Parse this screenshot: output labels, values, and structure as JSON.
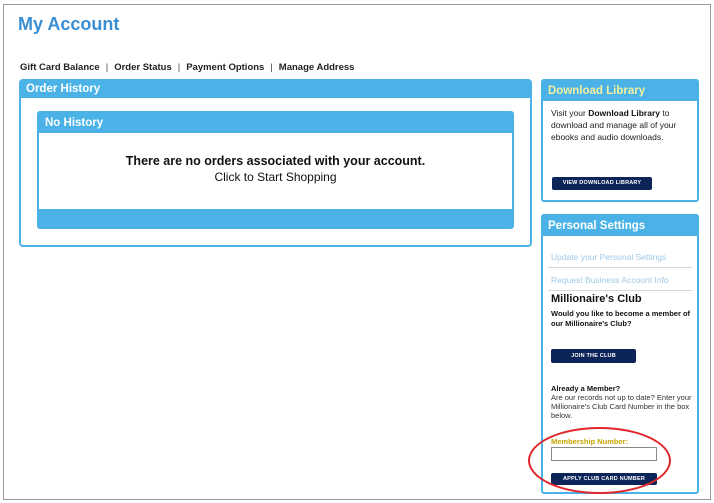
{
  "page": {
    "title": "My Account"
  },
  "nav": {
    "items": [
      "Gift Card Balance",
      "Order Status",
      "Payment Options",
      "Manage Address"
    ]
  },
  "order_history": {
    "title": "Order History",
    "panel_title": "No History",
    "message": "There are no orders associated with your account.",
    "link": "Click to Start Shopping"
  },
  "download_library": {
    "title": "Download Library",
    "text_pre": "Visit your",
    "text_bold": "Download Library",
    "text_post": "to download and manage all of your ebooks and audio downloads.",
    "button": "VIEW DOWNLOAD LIBRARY"
  },
  "personal_settings": {
    "title": "Personal Settings",
    "link_update": "Update your Personal Settings",
    "link_business": "Request Business Account Info",
    "club_title": "Millionaire's Club",
    "club_question": "Would you like to become a member of our Millionaire's Club?",
    "join_button": "JOIN THE CLUB",
    "member_title": "Already a Member?",
    "member_text": "Are our records not up to date? Enter your Millionaire's Club Card Number in the box below.",
    "membership_label": "Membership Number:",
    "membership_value": "",
    "apply_button": "APPLY CLUB CARD NUMBER"
  },
  "colors": {
    "accent": "#4ab2e6",
    "title": "#3a8fd4",
    "button": "#0c2458",
    "highlight": "#e0282c"
  }
}
